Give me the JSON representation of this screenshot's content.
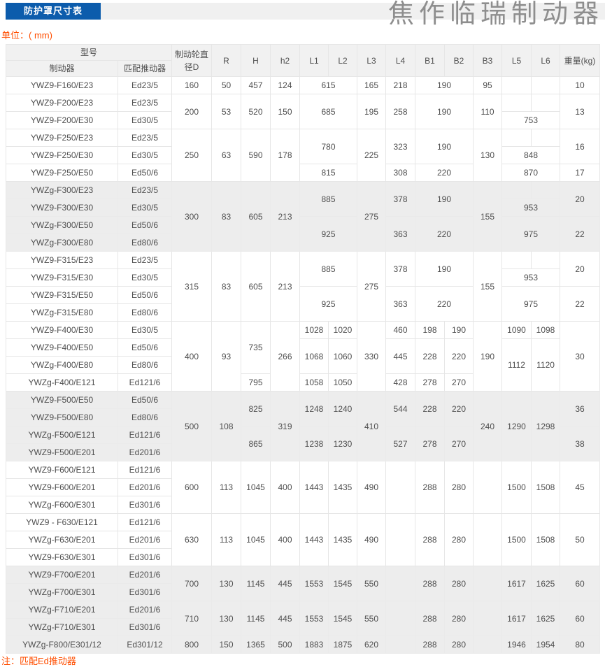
{
  "page": {
    "tab_label": "防护罩尺寸表",
    "watermark": "焦作临瑞制动器",
    "unit_label": "单位：( mm)",
    "footnote": "注：匹配Ed推动器"
  },
  "colors": {
    "tab_bg": "#0c5cac",
    "tab_text": "#ffffff",
    "strip_bg": "#f0f0f0",
    "accent_text": "#ff4e00",
    "table_text": "#4f4f4f",
    "border": "#e6e6e6",
    "shaded_row_bg": "#ededed",
    "header_bg": "#f1f1f1",
    "watermark_text": "#8e8e8e"
  },
  "table": {
    "header": {
      "model": "型号",
      "brake": "制动器",
      "thruster": "匹配推动器",
      "wheel_diameter": "制动轮直径D",
      "dims": [
        "R",
        "H",
        "h2",
        "L1",
        "L2",
        "L3",
        "L4",
        "B1",
        "B2",
        "B3",
        "L5",
        "L6"
      ],
      "weight": "重量(kg)"
    },
    "rows": [
      {
        "shade": false,
        "cells": [
          "YWZ9-F160/E23",
          "Ed23/5",
          "160",
          "50",
          "457",
          "124",
          {
            "t": "615",
            "cs": 2
          },
          "165",
          "218",
          {
            "t": "190",
            "cs": 2
          },
          "95",
          "",
          "",
          "10"
        ]
      },
      {
        "shade": false,
        "cells": [
          "YWZ9-F200/E23",
          "Ed23/5",
          {
            "t": "200",
            "rs": 2
          },
          {
            "t": "53",
            "rs": 2
          },
          {
            "t": "520",
            "rs": 2
          },
          {
            "t": "150",
            "rs": 2
          },
          {
            "t": "685",
            "cs": 2,
            "rs": 2
          },
          {
            "t": "195",
            "rs": 2
          },
          {
            "t": "258",
            "rs": 2
          },
          {
            "t": "190",
            "cs": 2,
            "rs": 2
          },
          {
            "t": "110",
            "rs": 2
          },
          "",
          "",
          {
            "t": "13",
            "rs": 2
          }
        ]
      },
      {
        "shade": false,
        "cells": [
          "YWZ9-F200/E30",
          "Ed30/5",
          {
            "t": "753",
            "cs": 2
          }
        ]
      },
      {
        "shade": false,
        "cells": [
          "YWZ9-F250/E23",
          "Ed23/5",
          {
            "t": "250",
            "rs": 3
          },
          {
            "t": "63",
            "rs": 3
          },
          {
            "t": "590",
            "rs": 3
          },
          {
            "t": "178",
            "rs": 3
          },
          {
            "t": "780",
            "cs": 2,
            "rs": 2
          },
          {
            "t": "225",
            "rs": 3
          },
          {
            "t": "323",
            "rs": 2
          },
          {
            "t": "190",
            "cs": 2,
            "rs": 2
          },
          {
            "t": "130",
            "rs": 3
          },
          "",
          "",
          {
            "t": "16",
            "rs": 2
          }
        ]
      },
      {
        "shade": false,
        "cells": [
          "YWZ9-F250/E30",
          "Ed30/5",
          {
            "t": "848",
            "cs": 2
          }
        ]
      },
      {
        "shade": false,
        "cells": [
          "YWZ9-F250/E50",
          "Ed50/6",
          {
            "t": "815",
            "cs": 2
          },
          "308",
          {
            "t": "220",
            "cs": 2
          },
          {
            "t": "870",
            "cs": 2
          },
          "17"
        ]
      },
      {
        "shade": true,
        "cells": [
          "YWZg-F300/E23",
          "Ed23/5",
          {
            "t": "300",
            "rs": 4
          },
          {
            "t": "83",
            "rs": 4
          },
          {
            "t": "605",
            "rs": 4
          },
          {
            "t": "213",
            "rs": 4
          },
          {
            "t": "885",
            "cs": 2,
            "rs": 2
          },
          {
            "t": "275",
            "rs": 4
          },
          {
            "t": "378",
            "rs": 2
          },
          {
            "t": "190",
            "cs": 2,
            "rs": 2
          },
          {
            "t": "155",
            "rs": 4
          },
          "",
          "",
          {
            "t": "20",
            "rs": 2
          }
        ]
      },
      {
        "shade": true,
        "cells": [
          "YWZ9-F300/E30",
          "Ed30/5",
          {
            "t": "953",
            "cs": 2
          }
        ]
      },
      {
        "shade": true,
        "cells": [
          "YWZg-F300/E50",
          "Ed50/6",
          {
            "t": "925",
            "cs": 2,
            "rs": 2
          },
          {
            "t": "363",
            "rs": 2
          },
          {
            "t": "220",
            "cs": 2,
            "rs": 2
          },
          {
            "t": "975",
            "cs": 2,
            "rs": 2
          },
          {
            "t": "22",
            "rs": 2
          }
        ]
      },
      {
        "shade": true,
        "cells": [
          "YWZg-F300/E80",
          "Ed80/6"
        ]
      },
      {
        "shade": false,
        "cells": [
          "YWZ9-F315/E23",
          "Ed23/5",
          {
            "t": "315",
            "rs": 4
          },
          {
            "t": "83",
            "rs": 4
          },
          {
            "t": "605",
            "rs": 4
          },
          {
            "t": "213",
            "rs": 4
          },
          {
            "t": "885",
            "cs": 2,
            "rs": 2
          },
          {
            "t": "275",
            "rs": 4
          },
          {
            "t": "378",
            "rs": 2
          },
          {
            "t": "190",
            "cs": 2,
            "rs": 2
          },
          {
            "t": "155",
            "rs": 4
          },
          "",
          "",
          {
            "t": "20",
            "rs": 2
          }
        ]
      },
      {
        "shade": false,
        "cells": [
          "YWZ9-F315/E30",
          "Ed30/5",
          {
            "t": "953",
            "cs": 2
          }
        ]
      },
      {
        "shade": false,
        "cells": [
          "YWZ9-F315/E50",
          "Ed50/6",
          {
            "t": "925",
            "cs": 2,
            "rs": 2
          },
          {
            "t": "363",
            "rs": 2
          },
          {
            "t": "220",
            "cs": 2,
            "rs": 2
          },
          {
            "t": "975",
            "cs": 2,
            "rs": 2
          },
          {
            "t": "22",
            "rs": 2
          }
        ]
      },
      {
        "shade": false,
        "cells": [
          "YWZg-F315/E80",
          "Ed80/6"
        ]
      },
      {
        "shade": false,
        "cells": [
          "YWZ9-F400/E30",
          "Ed30/5",
          {
            "t": "400",
            "rs": 4
          },
          {
            "t": "93",
            "rs": 4
          },
          {
            "t": "735",
            "rs": 3
          },
          {
            "t": "266",
            "rs": 4
          },
          "1028",
          "1020",
          {
            "t": "330",
            "rs": 4
          },
          "460",
          "198",
          "190",
          {
            "t": "190",
            "rs": 4
          },
          "1090",
          "1098",
          {
            "t": "30",
            "rs": 4
          }
        ]
      },
      {
        "shade": false,
        "cells": [
          "YWZ9-F400/E50",
          "Ed50/6",
          {
            "t": "1068",
            "rs": 2
          },
          {
            "t": "1060",
            "rs": 2
          },
          {
            "t": "445",
            "rs": 2
          },
          {
            "t": "228",
            "rs": 2
          },
          {
            "t": "220",
            "rs": 2
          },
          {
            "t": "1112",
            "rs": 3
          },
          {
            "t": "1120",
            "rs": 3
          }
        ]
      },
      {
        "shade": false,
        "cells": [
          "YWZg-F400/E80",
          "Ed80/6"
        ]
      },
      {
        "shade": false,
        "cells": [
          "YWZg-F400/E121",
          "Ed121/6",
          "795",
          "1058",
          "1050",
          "428",
          "278",
          "270"
        ]
      },
      {
        "shade": true,
        "cells": [
          "YWZ9-F500/E50",
          "Ed50/6",
          {
            "t": "500",
            "rs": 4
          },
          {
            "t": "108",
            "rs": 4
          },
          {
            "t": "825",
            "rs": 2
          },
          {
            "t": "319",
            "rs": 4
          },
          {
            "t": "1248",
            "rs": 2
          },
          {
            "t": "1240",
            "rs": 2
          },
          {
            "t": "410",
            "rs": 4
          },
          {
            "t": "544",
            "rs": 2
          },
          {
            "t": "228",
            "rs": 2
          },
          {
            "t": "220",
            "rs": 2
          },
          {
            "t": "240",
            "rs": 4
          },
          {
            "t": "1290",
            "rs": 4
          },
          {
            "t": "1298",
            "rs": 4
          },
          {
            "t": "36",
            "rs": 2
          }
        ]
      },
      {
        "shade": true,
        "cells": [
          "YWZ9-F500/E80",
          "Ed80/6"
        ]
      },
      {
        "shade": true,
        "cells": [
          "YWZg-F500/E121",
          "Ed121/6",
          {
            "t": "865",
            "rs": 2
          },
          {
            "t": "1238",
            "rs": 2
          },
          {
            "t": "1230",
            "rs": 2
          },
          {
            "t": "527",
            "rs": 2
          },
          {
            "t": "278",
            "rs": 2
          },
          {
            "t": "270",
            "rs": 2
          },
          {
            "t": "38",
            "rs": 2
          }
        ]
      },
      {
        "shade": true,
        "cells": [
          "YWZ9-F500/E201",
          "Ed201/6"
        ]
      },
      {
        "shade": false,
        "cells": [
          "YWZ9-F600/E121",
          "Ed121/6",
          {
            "t": "600",
            "rs": 3
          },
          {
            "t": "113",
            "rs": 3
          },
          {
            "t": "1045",
            "rs": 3
          },
          {
            "t": "400",
            "rs": 3
          },
          {
            "t": "1443",
            "rs": 3
          },
          {
            "t": "1435",
            "rs": 3
          },
          {
            "t": "490",
            "rs": 3
          },
          {
            "t": "",
            "rs": 3
          },
          {
            "t": "288",
            "rs": 3
          },
          {
            "t": "280",
            "rs": 3
          },
          {
            "t": "",
            "rs": 3
          },
          {
            "t": "1500",
            "rs": 3
          },
          {
            "t": "1508",
            "rs": 3
          },
          {
            "t": "45",
            "rs": 3
          }
        ]
      },
      {
        "shade": false,
        "cells": [
          "YWZ9-F600/E201",
          "Ed201/6"
        ]
      },
      {
        "shade": false,
        "cells": [
          "YWZg-F600/E301",
          "Ed301/6"
        ]
      },
      {
        "shade": false,
        "cells": [
          "YWZ9 - F630/E121",
          "Ed121/6",
          {
            "t": "630",
            "rs": 3
          },
          {
            "t": "113",
            "rs": 3
          },
          {
            "t": "1045",
            "rs": 3
          },
          {
            "t": "400",
            "rs": 3
          },
          {
            "t": "1443",
            "rs": 3
          },
          {
            "t": "1435",
            "rs": 3
          },
          {
            "t": "490",
            "rs": 3
          },
          {
            "t": "",
            "rs": 3
          },
          {
            "t": "288",
            "rs": 3
          },
          {
            "t": "280",
            "rs": 3
          },
          {
            "t": "",
            "rs": 3
          },
          {
            "t": "1500",
            "rs": 3
          },
          {
            "t": "1508",
            "rs": 3
          },
          {
            "t": "50",
            "rs": 3
          }
        ]
      },
      {
        "shade": false,
        "cells": [
          "YWZg-F630/E201",
          "Ed201/6"
        ]
      },
      {
        "shade": false,
        "cells": [
          "YWZ9-F630/E301",
          "Ed301/6"
        ]
      },
      {
        "shade": true,
        "cells": [
          "YWZ9-F700/E201",
          "Ed201/6",
          {
            "t": "700",
            "rs": 2
          },
          {
            "t": "130",
            "rs": 2
          },
          {
            "t": "1145",
            "rs": 2
          },
          {
            "t": "445",
            "rs": 2
          },
          {
            "t": "1553",
            "rs": 2
          },
          {
            "t": "1545",
            "rs": 2
          },
          {
            "t": "550",
            "rs": 2
          },
          {
            "t": "",
            "rs": 2
          },
          {
            "t": "288",
            "rs": 2
          },
          {
            "t": "280",
            "rs": 2
          },
          {
            "t": "",
            "rs": 2
          },
          {
            "t": "1617",
            "rs": 2
          },
          {
            "t": "1625",
            "rs": 2
          },
          {
            "t": "60",
            "rs": 2
          }
        ]
      },
      {
        "shade": true,
        "cells": [
          "YWZg-F700/E301",
          "Ed301/6"
        ]
      },
      {
        "shade": true,
        "cells": [
          "YWZg-F710/E201",
          "Ed201/6",
          {
            "t": "710",
            "rs": 2
          },
          {
            "t": "130",
            "rs": 2
          },
          {
            "t": "1145",
            "rs": 2
          },
          {
            "t": "445",
            "rs": 2
          },
          {
            "t": "1553",
            "rs": 2
          },
          {
            "t": "1545",
            "rs": 2
          },
          {
            "t": "550",
            "rs": 2
          },
          {
            "t": "",
            "rs": 2
          },
          {
            "t": "288",
            "rs": 2
          },
          {
            "t": "280",
            "rs": 2
          },
          {
            "t": "",
            "rs": 2
          },
          {
            "t": "1617",
            "rs": 2
          },
          {
            "t": "1625",
            "rs": 2
          },
          {
            "t": "60",
            "rs": 2
          }
        ]
      },
      {
        "shade": true,
        "cells": [
          "YWZg-F710/E301",
          "Ed301/6"
        ]
      },
      {
        "shade": true,
        "cells": [
          "YWZg-F800/E301/12",
          "Ed301/12",
          "800",
          "150",
          "1365",
          "500",
          "1883",
          "1875",
          "620",
          "",
          "288",
          "280",
          "",
          "1946",
          "1954",
          "80"
        ]
      }
    ]
  }
}
